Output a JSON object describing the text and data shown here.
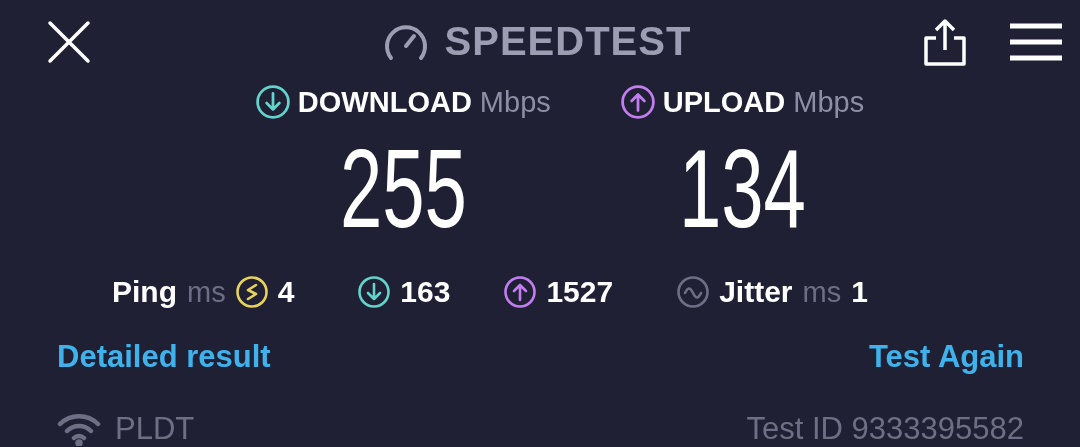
{
  "header": {
    "title": "SPEEDTEST"
  },
  "results": [
    {
      "kind": "download",
      "label": "DOWNLOAD",
      "unit": "Mbps",
      "value": "255"
    },
    {
      "kind": "upload",
      "label": "UPLOAD",
      "unit": "Mbps",
      "value": "134"
    }
  ],
  "stats": [
    {
      "kind": "ping",
      "label": "Ping",
      "unit": "ms",
      "value": "4"
    },
    {
      "kind": "download",
      "value": "163"
    },
    {
      "kind": "upload",
      "value": "1527"
    },
    {
      "kind": "jitter",
      "label": "Jitter",
      "unit": "ms",
      "value": "1"
    }
  ],
  "links": [
    "Detailed result",
    "Test Again"
  ],
  "footer": {
    "network": "PLDT",
    "test_id": "Test ID 9333395582"
  }
}
